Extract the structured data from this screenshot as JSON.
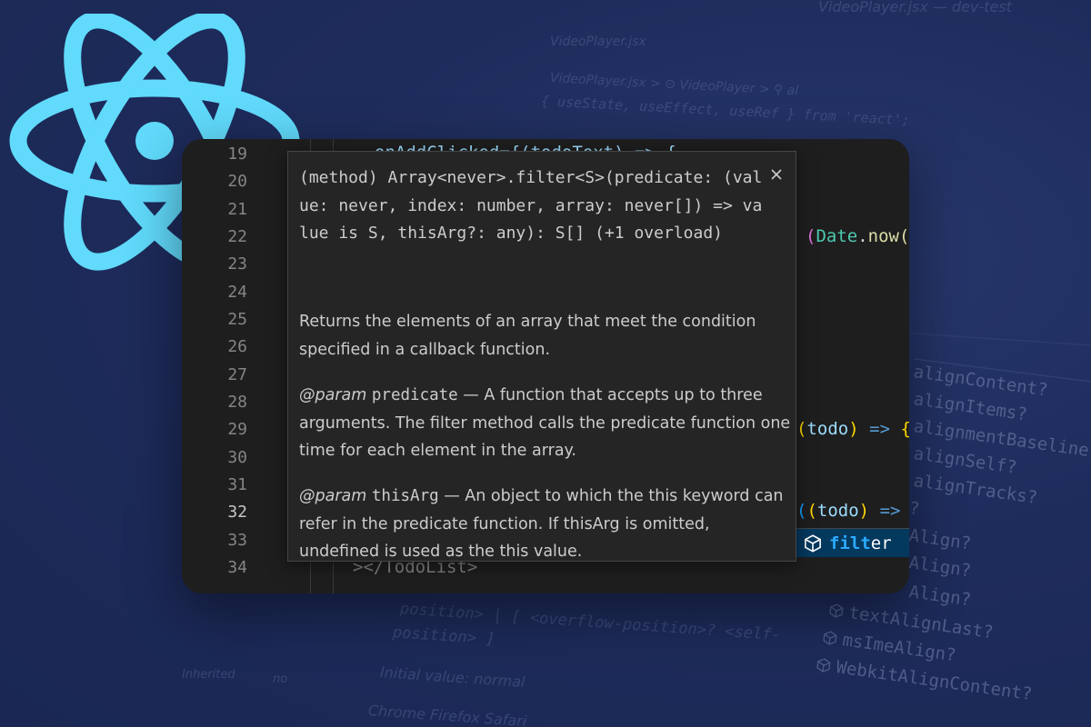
{
  "background": {
    "title_bar": "VideoPlayer.jsx — dev-test",
    "tab": "VideoPlayer.jsx",
    "breadcrumb": "VideoPlayer.jsx > ⊙ VideoPlayer > ⚲ al",
    "import_line": "{ useState, useEffect, useRef } from 'react';",
    "css_snippet_1": "position> | [ <overflow-position>? <self-",
    "css_snippet_2": "position> ]",
    "css_snippet_3": "position> | [ <overflow-position>? <self-",
    "initial_value": "Initial value:  normal",
    "browsers": "Chrome Firefox Safari",
    "label_1": "Inherited",
    "label_2": "no",
    "suggestions": [
      "alignContent?",
      "alignItems?",
      "alignmentBaseline?",
      "alignSelf?",
      "alignTracks?",
      "?",
      "Align?",
      "Align?",
      "Align?",
      "textAlignLast?",
      "msImeAlign?",
      "WebkitAlignContent?"
    ]
  },
  "editor": {
    "line_numbers": [
      "19",
      "20",
      "21",
      "22",
      "23",
      "24",
      "25",
      "26",
      "27",
      "28",
      "29",
      "30",
      "31",
      "32",
      "33",
      "34"
    ],
    "active_line": "32",
    "code": {
      "line19": "onAddClicked={(todoText) => {",
      "line22_paren": "(",
      "line22_date": "Date",
      "line22_dot": ".",
      "line22_now": "now(",
      "line29_open": "(",
      "line29_param": "todo",
      "line29_close": ")",
      "line29_arrow": "=>",
      "line29_brace": "{",
      "line32_open": "(",
      "line32_paren": "(",
      "line32_param": "todo",
      "line32_close": ")",
      "line32_arrow": "=>",
      "line34": "></TodoList>"
    },
    "suggestion": {
      "match": "filt",
      "rest": "er",
      "icon": "cube-icon"
    }
  },
  "hover": {
    "signature": "(method) Array<never>.filter<S>(predicate: (value: never, index: number, array: never[]) => value is S, thisArg?: any): S[] (+1 overload)",
    "close_icon": "close-icon",
    "description": "Returns the elements of an array that meet the condition specified in a callback function.",
    "params": [
      {
        "tag": "@param",
        "name": "predicate",
        "text": "— A function that accepts up to three arguments. The filter method calls the predicate function one time for each element in the array."
      },
      {
        "tag": "@param",
        "name": "thisArg",
        "text": "— An object to which the this keyword can refer in the predicate function. If thisArg is omitted, undefined is used as the this value."
      }
    ]
  },
  "colors": {
    "background": "#1d2b5a",
    "react_logo": "#61dafb",
    "editor_bg": "#1e1e1e",
    "hover_bg": "#252526",
    "suggest_highlight": "#04395e"
  }
}
